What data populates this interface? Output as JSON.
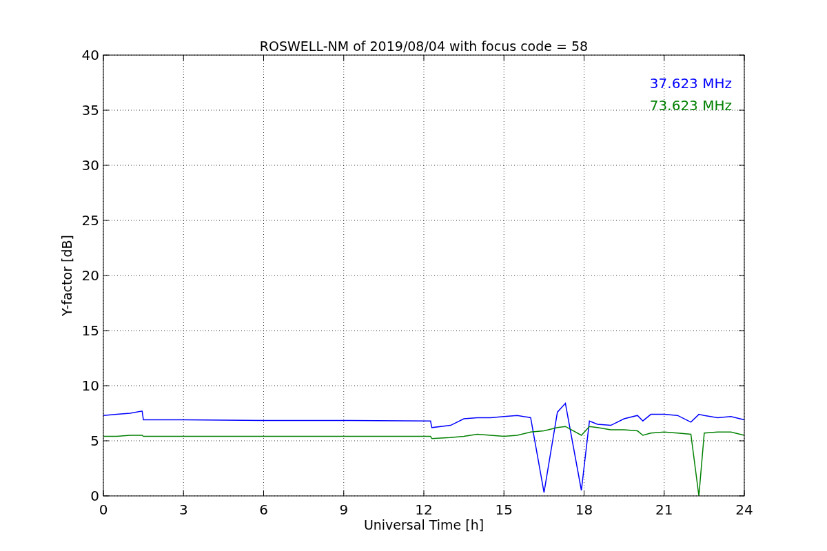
{
  "chart_data": {
    "type": "line",
    "title": "ROSWELL-NM of 2019/08/04 with focus code = 58",
    "xlabel": "Universal Time [h]",
    "ylabel": "Y-factor [dB]",
    "x": [
      0,
      0.5,
      1,
      1.45,
      1.5,
      3,
      6,
      9,
      12.25,
      12.3,
      13,
      13.5,
      14,
      14.5,
      15,
      15.5,
      16,
      16.5,
      17,
      17.3,
      17.9,
      18.2,
      18.5,
      19,
      19.5,
      20,
      20.2,
      20.5,
      21,
      21.5,
      22,
      22.3,
      22.5,
      23,
      23.5,
      24
    ],
    "series": [
      {
        "name": "37.623 MHz",
        "color": "#0000ff",
        "values": [
          7.3,
          7.4,
          7.5,
          7.7,
          6.9,
          6.9,
          6.85,
          6.85,
          6.8,
          6.2,
          6.4,
          7.0,
          7.1,
          7.1,
          7.2,
          7.3,
          7.1,
          0.3,
          7.6,
          8.4,
          0.5,
          6.8,
          6.5,
          6.4,
          7.0,
          7.3,
          6.8,
          7.4,
          7.4,
          7.3,
          6.7,
          7.4,
          7.3,
          7.1,
          7.2,
          6.9
        ]
      },
      {
        "name": "73.623 MHz",
        "color": "#008000",
        "values": [
          5.4,
          5.4,
          5.5,
          5.5,
          5.4,
          5.4,
          5.4,
          5.4,
          5.4,
          5.2,
          5.3,
          5.4,
          5.6,
          5.5,
          5.4,
          5.5,
          5.8,
          5.9,
          6.2,
          6.3,
          5.5,
          6.3,
          6.2,
          6.0,
          6.0,
          5.9,
          5.5,
          5.7,
          5.8,
          5.7,
          5.6,
          0.0,
          5.7,
          5.8,
          5.8,
          5.5
        ]
      }
    ],
    "grid": true,
    "xlim": [
      0,
      24
    ],
    "ylim": [
      0,
      40
    ],
    "xticks": [
      0,
      3,
      6,
      9,
      12,
      15,
      18,
      21,
      24
    ],
    "yticks": [
      0,
      5,
      10,
      15,
      20,
      25,
      30,
      35,
      40
    ]
  }
}
